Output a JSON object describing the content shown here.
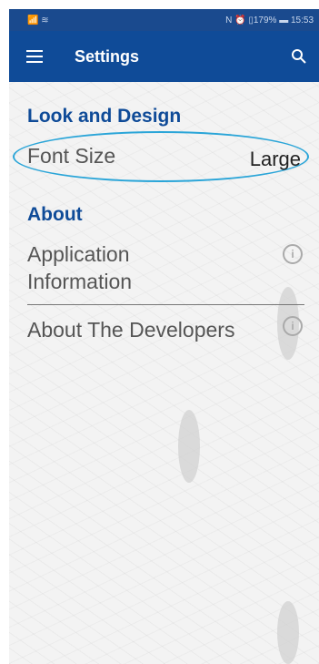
{
  "status_bar": {
    "left": "📶 ≋",
    "right": "N ⏰ ▯179% ▬ 15:53"
  },
  "app_bar": {
    "title": "Settings"
  },
  "sections": {
    "look": {
      "title": "Look and Design",
      "font_size_label": "Font Size",
      "font_size_value": "Large"
    },
    "about": {
      "title": "About",
      "app_info_label": "Application Information",
      "developers_label": "About The Developers"
    }
  },
  "icons": {
    "menu": "hamburger-icon",
    "search": "search-icon",
    "info": "info-icon"
  }
}
